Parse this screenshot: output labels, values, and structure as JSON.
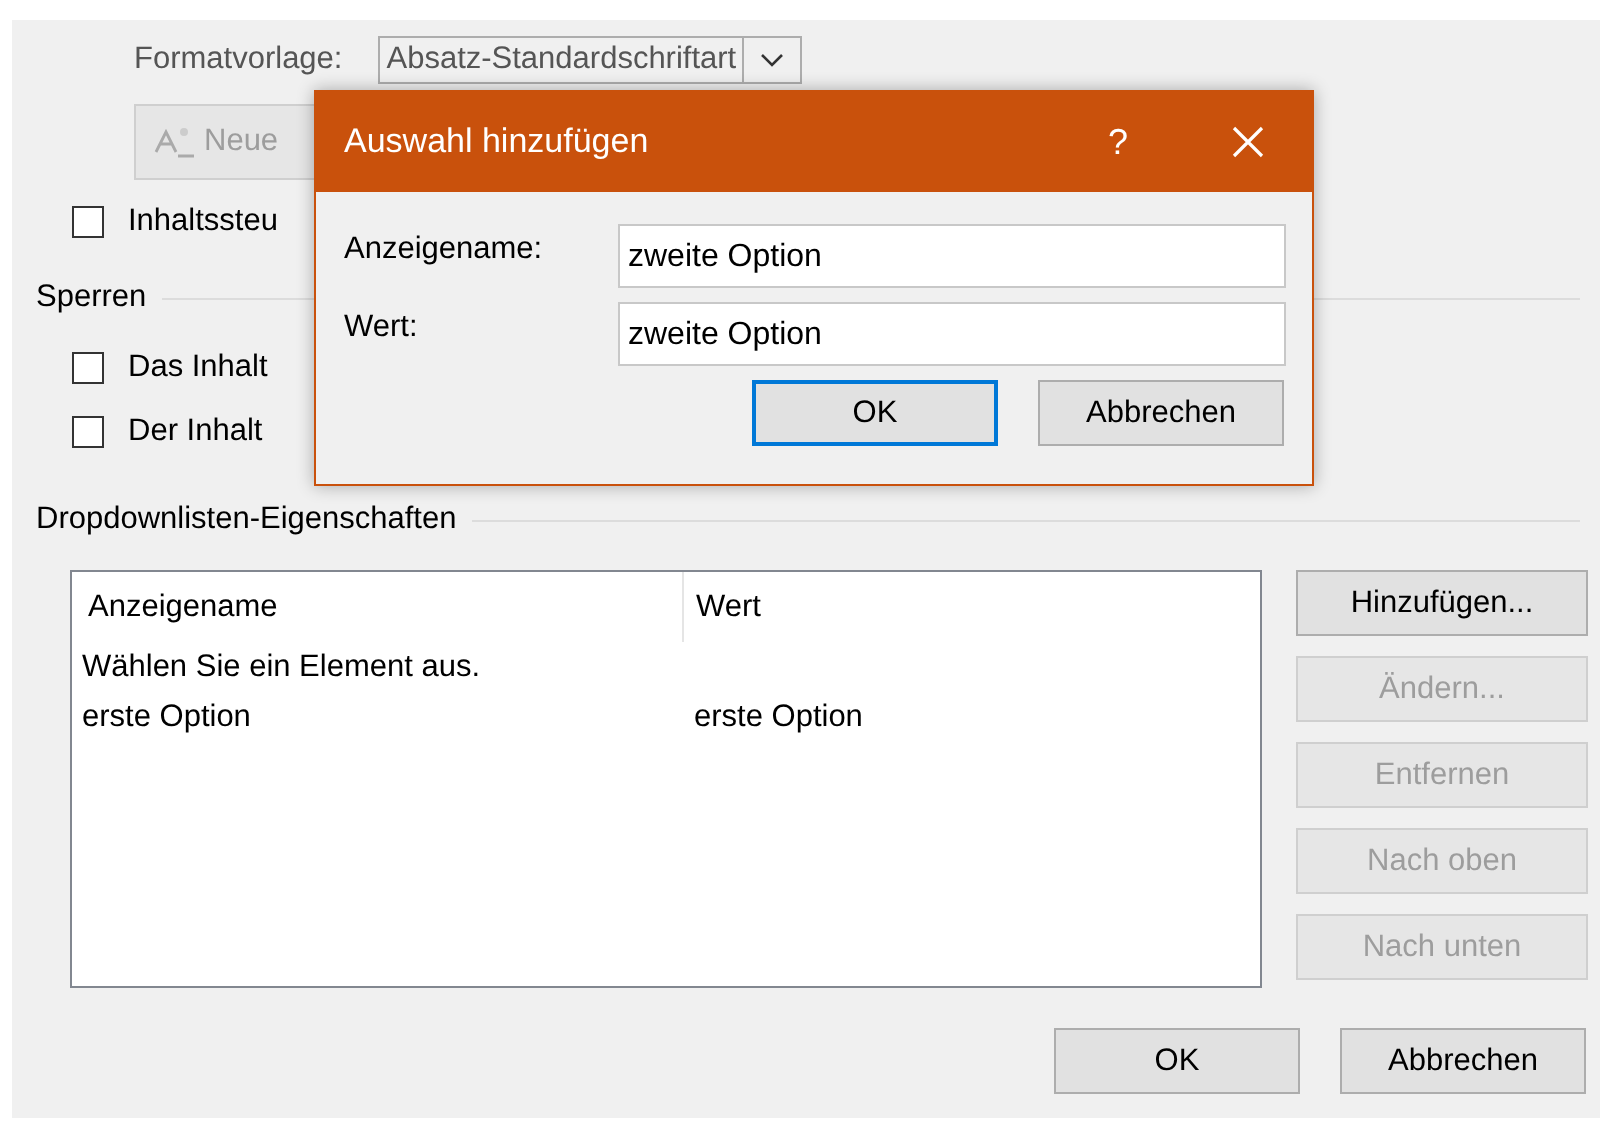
{
  "dialog": {
    "style_label": "Formatvorlage:",
    "style_value": "Absatz-Standardschriftart",
    "new_style_button": {
      "label": "Neue",
      "disabled": true
    },
    "checkboxes": [
      {
        "label": "Inhaltssteu",
        "checked": false
      }
    ],
    "locking": {
      "title": "Sperren",
      "checkboxes": [
        {
          "label": "Das Inhalt",
          "checked": false
        },
        {
          "label": "Der Inhalt",
          "checked": false
        }
      ]
    },
    "list_properties": {
      "title": "Dropdownlisten-Eigenschaften",
      "columns": [
        "Anzeigename",
        "Wert"
      ],
      "rows": [
        {
          "name": "Wählen Sie ein Element aus."
        },
        {
          "name": "erste Option",
          "value": "erste Option"
        }
      ],
      "side_buttons": [
        {
          "label": "Hinzufügen...",
          "disabled": false
        },
        {
          "label": "Ändern...",
          "disabled": true
        },
        {
          "label": "Entfernen",
          "disabled": true
        },
        {
          "label": "Nach oben",
          "disabled": true
        },
        {
          "label": "Nach unten",
          "disabled": true
        }
      ]
    },
    "buttons": [
      {
        "label": "OK",
        "disabled": false
      },
      {
        "label": "Abbrechen",
        "disabled": false
      }
    ]
  },
  "add_choice_dialog": {
    "title": "Auswahl hinzufügen",
    "help": "?",
    "fields": [
      {
        "label": "Anzeigename:",
        "value": "zweite Option"
      },
      {
        "label": "Wert:",
        "value": "zweite Option"
      }
    ],
    "buttons": [
      {
        "label": "OK",
        "default": true
      },
      {
        "label": "Abbrechen",
        "default": false
      }
    ]
  }
}
